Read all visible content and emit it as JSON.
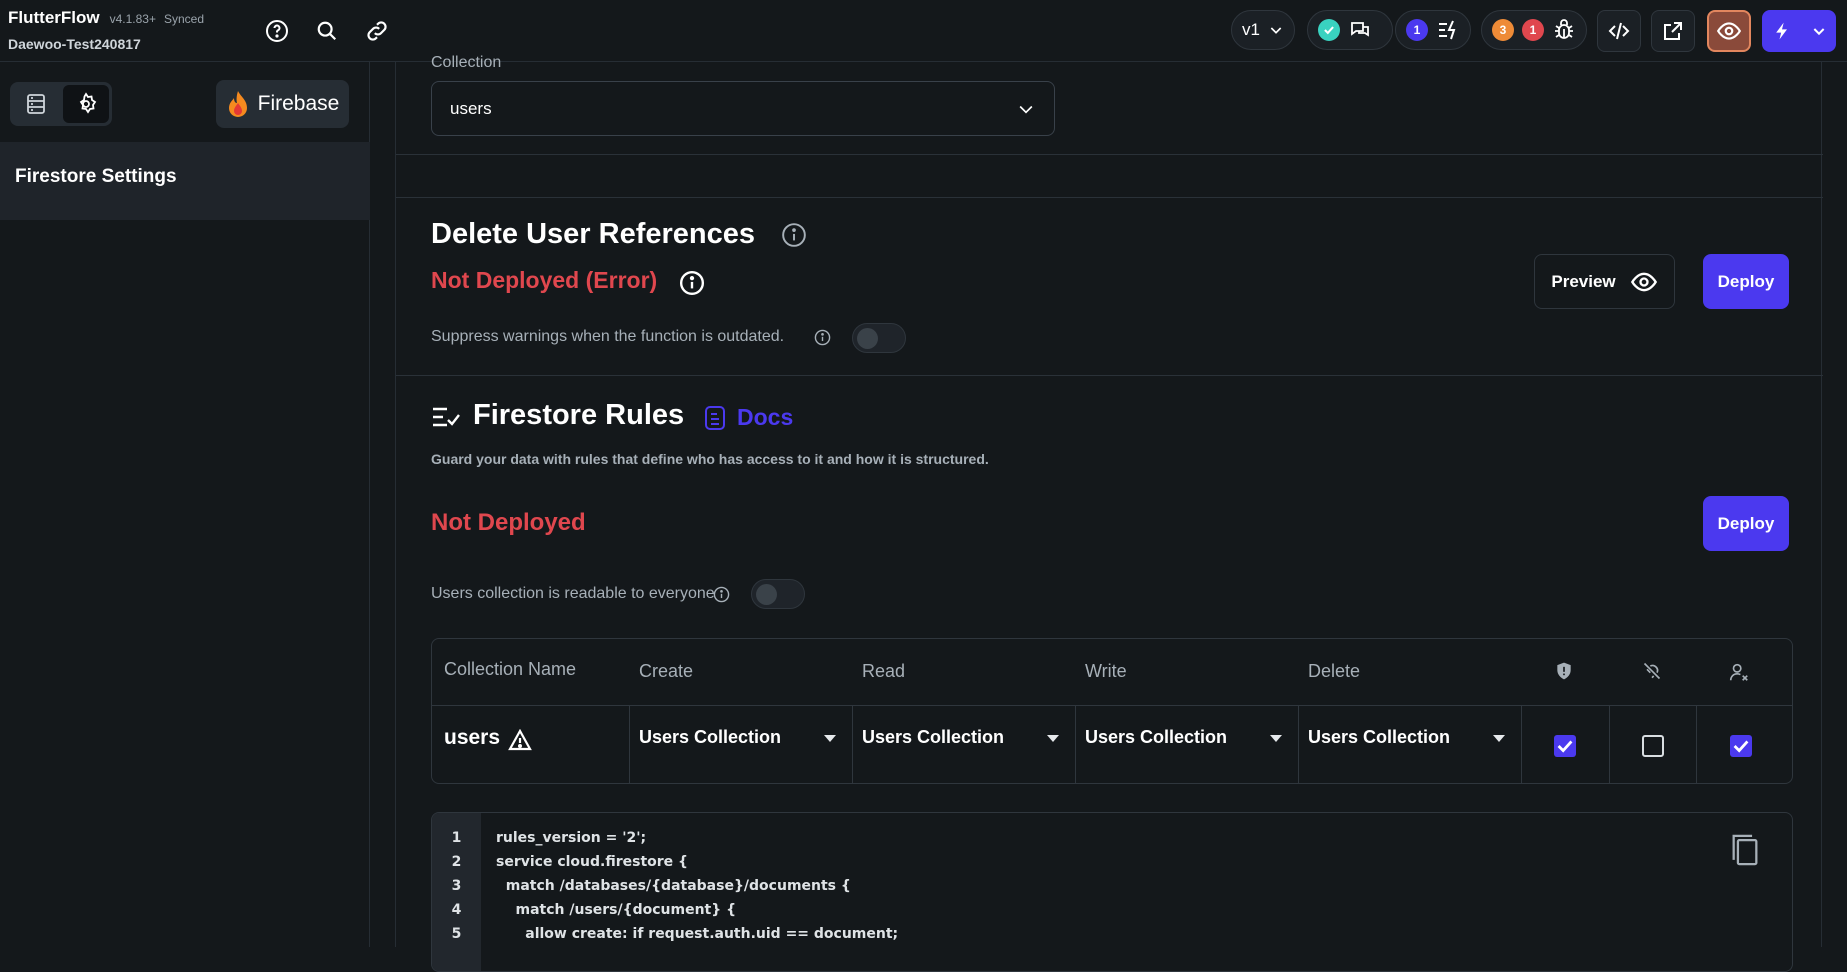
{
  "app": {
    "name": "FlutterFlow",
    "version": "v4.1.83+",
    "sync_status": "Synced",
    "project": "Daewoo-Test240817"
  },
  "topbar": {
    "version_selector": "v1",
    "notifications": {
      "info_count": "1",
      "warning_count": "3",
      "error_count": "1"
    }
  },
  "sidebar": {
    "firebase_label": "Firebase",
    "item": "Firestore Settings"
  },
  "collection_section": {
    "label": "Collection",
    "value": "users"
  },
  "delete_refs": {
    "title": "Delete User References",
    "status": "Not Deployed (Error)",
    "suppress_label": "Suppress warnings when the function is outdated.",
    "preview_label": "Preview",
    "deploy_label": "Deploy"
  },
  "rules": {
    "title": "Firestore Rules",
    "docs_label": "Docs",
    "description": "Guard your data with rules that define who has access to it and how it is structured.",
    "status": "Not Deployed",
    "deploy_label": "Deploy",
    "readable_label": "Users collection is readable to everyone"
  },
  "table": {
    "headers": [
      "Collection Name",
      "Create",
      "Read",
      "Write",
      "Delete"
    ],
    "row": {
      "name": "users",
      "create": "Users Collection",
      "read": "Users Collection",
      "write": "Users Collection",
      "delete": "Users Collection",
      "checks": [
        true,
        false,
        true
      ]
    }
  },
  "code": {
    "line_numbers": [
      "1",
      "2",
      "3",
      "4",
      "5"
    ],
    "lines": [
      "rules_version = '2';",
      "service cloud.firestore {",
      "  match /databases/{database}/documents {",
      "    match /users/{document} {",
      "      allow create: if request.auth.uid == document;"
    ]
  },
  "colors": {
    "accent": "#4b39ef",
    "error": "#e0474e",
    "success": "#39d2c0",
    "warning": "#ee8b37"
  }
}
